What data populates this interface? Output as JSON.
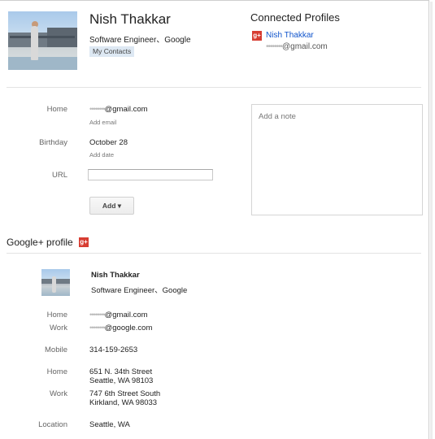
{
  "header": {
    "name": "Nish Thakkar",
    "job": "Software Engineer、Google",
    "group_tag": "My Contacts"
  },
  "connected_profiles": {
    "title": "Connected Profiles",
    "badge": "g+",
    "name": "Nish Thakkar",
    "email_masked": "••••••••",
    "email_domain": "@gmail.com"
  },
  "contact_fields": {
    "home_label": "Home",
    "home_email_masked": "••••••••",
    "home_email_domain": "@gmail.com",
    "add_email": "Add email",
    "birthday_label": "Birthday",
    "birthday_value": "October 28",
    "add_date": "Add date",
    "url_label": "URL",
    "url_value": "",
    "add_button": "Add ▾"
  },
  "note": {
    "placeholder": "Add a note"
  },
  "gplus": {
    "title": "Google+ profile",
    "badge": "g+",
    "name": "Nish Thakkar",
    "job": "Software Engineer、Google",
    "rows": {
      "home_email": {
        "label": "Home",
        "masked": "••••••••",
        "domain": "@gmail.com"
      },
      "work_email": {
        "label": "Work",
        "masked": "••••••••",
        "domain": "@google.com"
      },
      "mobile": {
        "label": "Mobile",
        "value": "314-159-2653"
      },
      "home_address": {
        "label": "Home",
        "line1": "651 N. 34th Street",
        "line2": "Seattle, WA 98103"
      },
      "work_address": {
        "label": "Work",
        "line1": "747 6th Street South",
        "line2": "Kirkland, WA 98033"
      },
      "location": {
        "label": "Location",
        "value": "Seattle, WA"
      }
    }
  },
  "colors": {
    "link": "#1155cc",
    "gplus_red": "#d73d32",
    "tag_bg": "#dde8f3"
  }
}
